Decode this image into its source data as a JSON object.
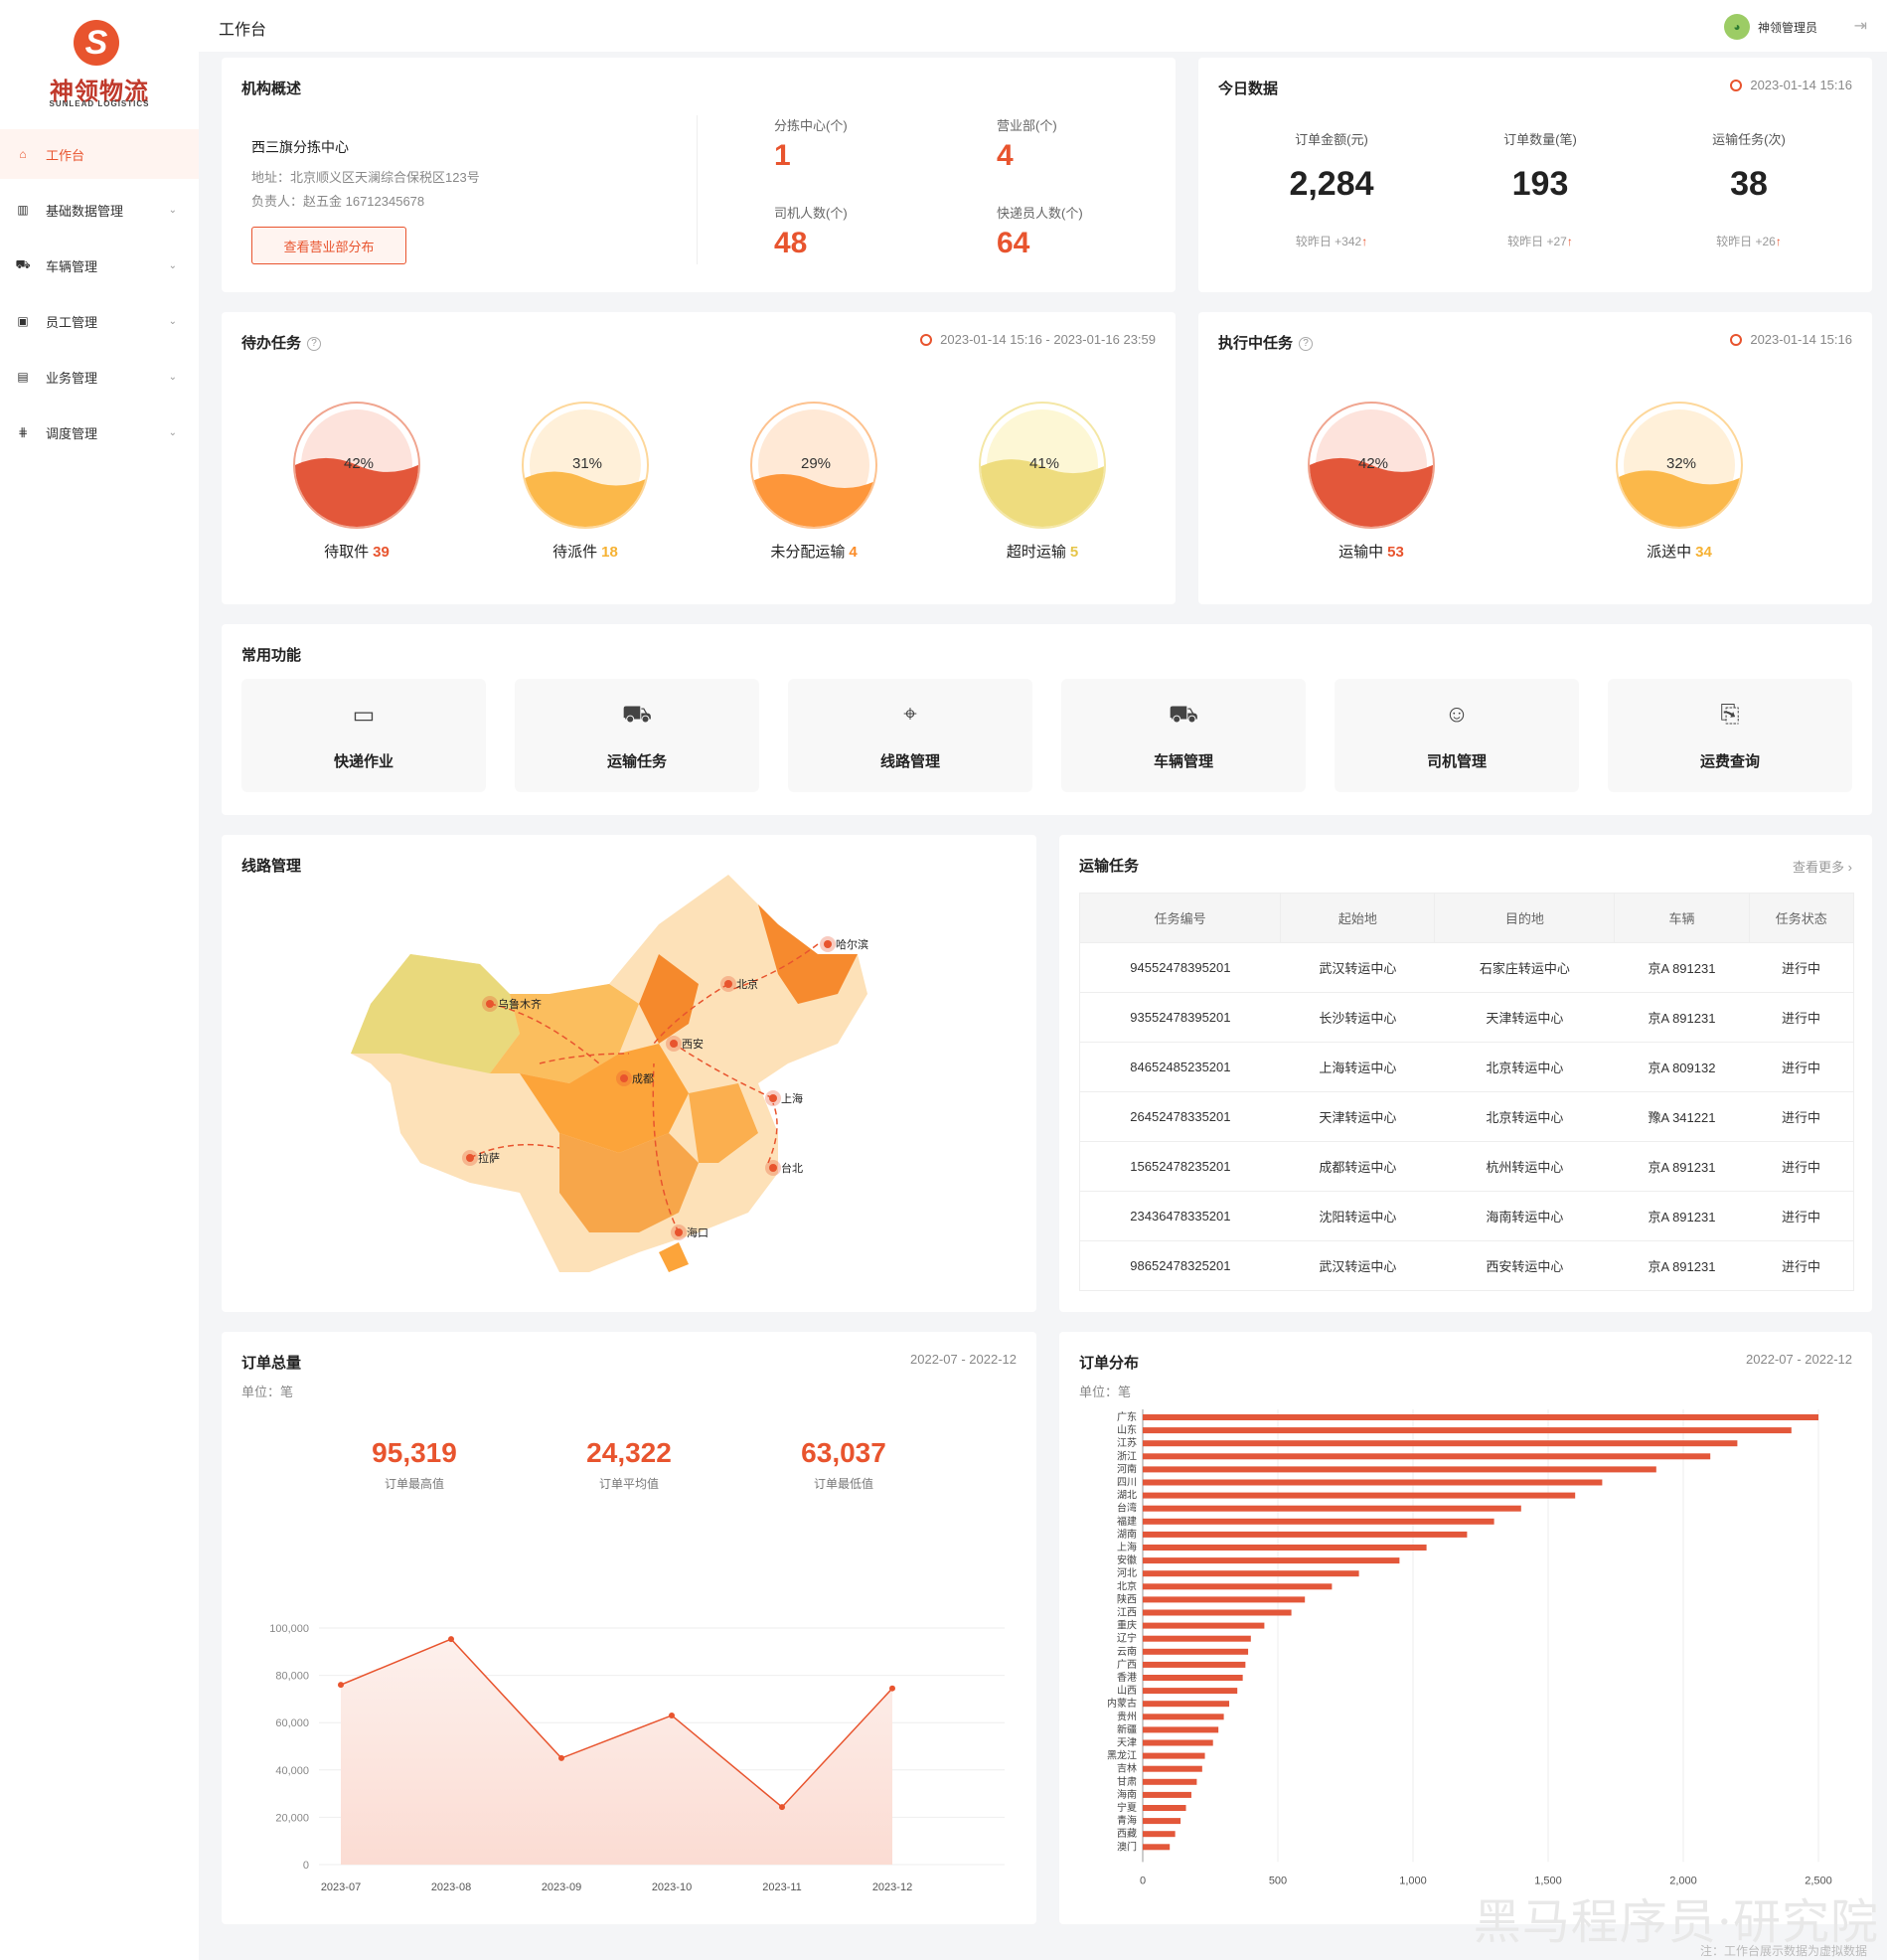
{
  "logo": {
    "mark": "S",
    "cn": "神领物流",
    "en": "SUNLEAD LOGISTICS"
  },
  "sidebar": {
    "items": [
      {
        "label": "工作台",
        "icon": "home-icon",
        "glyph": "⌂"
      },
      {
        "label": "基础数据管理",
        "icon": "bar-chart-icon",
        "glyph": "▥"
      },
      {
        "label": "车辆管理",
        "icon": "truck-icon",
        "glyph": "⛟"
      },
      {
        "label": "员工管理",
        "icon": "badge-icon",
        "glyph": "▣"
      },
      {
        "label": "业务管理",
        "icon": "document-icon",
        "glyph": "▤"
      },
      {
        "label": "调度管理",
        "icon": "dispatch-icon",
        "glyph": "⋕"
      }
    ]
  },
  "header": {
    "title": "工作台",
    "user": "神领管理员"
  },
  "org": {
    "title": "机构概述",
    "name": "西三旗分拣中心",
    "address": "地址：北京顺义区天澜综合保税区123号",
    "manager": "负责人：赵五金 16712345678",
    "button": "查看营业部分布",
    "stats": [
      {
        "label": "分拣中心(个)",
        "value": "1"
      },
      {
        "label": "营业部(个)",
        "value": "4"
      },
      {
        "label": "司机人数(个)",
        "value": "48"
      },
      {
        "label": "快递员人数(个)",
        "value": "64"
      }
    ]
  },
  "today": {
    "title": "今日数据",
    "time": "2023-01-14 15:16",
    "items": [
      {
        "label": "订单金额(元)",
        "value": "2,284",
        "compare": "较昨日 +342"
      },
      {
        "label": "订单数量(笔)",
        "value": "193",
        "compare": "较昨日 +27"
      },
      {
        "label": "运输任务(次)",
        "value": "38",
        "compare": "较昨日 +26"
      }
    ]
  },
  "pending": {
    "title": "待办任务",
    "range": "2023-01-14 15:16 - 2023-01-16 23:59",
    "gauges": [
      {
        "pct": "42%",
        "level": 0.42,
        "label": "待取件",
        "count": "39",
        "color": "#e3573a",
        "bg": "#fde3dc",
        "ring": "#f0a58f",
        "ncolor": "#e8542e"
      },
      {
        "pct": "31%",
        "level": 0.31,
        "label": "待派件",
        "count": "18",
        "color": "#fbb84a",
        "bg": "#fff0d9",
        "ring": "#fdd79a",
        "ncolor": "#f6b234"
      },
      {
        "pct": "29%",
        "level": 0.29,
        "label": "未分配运输",
        "count": "4",
        "color": "#fd963a",
        "bg": "#ffe9d6",
        "ring": "#fdc28f",
        "ncolor": "#fb8d2b"
      },
      {
        "pct": "41%",
        "level": 0.41,
        "label": "超时运输",
        "count": "5",
        "color": "#eedc7e",
        "bg": "#fdf7d5",
        "ring": "#f4e7a6",
        "ncolor": "#e6c54a"
      }
    ]
  },
  "executing": {
    "title": "执行中任务",
    "time": "2023-01-14 15:16",
    "gauges": [
      {
        "pct": "42%",
        "level": 0.42,
        "label": "运输中",
        "count": "53",
        "color": "#e3573a",
        "bg": "#fde3dc",
        "ring": "#f0a58f",
        "ncolor": "#e8542e"
      },
      {
        "pct": "32%",
        "level": 0.32,
        "label": "派送中",
        "count": "34",
        "color": "#fbb84a",
        "bg": "#fff0d9",
        "ring": "#fdd79a",
        "ncolor": "#f6b234"
      }
    ]
  },
  "functions": {
    "title": "常用功能",
    "items": [
      {
        "label": "快递作业",
        "icon": "parcel-box-icon",
        "glyph": "▭"
      },
      {
        "label": "运输任务",
        "icon": "transport-truck-icon",
        "glyph": "⛟"
      },
      {
        "label": "线路管理",
        "icon": "route-icon",
        "glyph": "⌖"
      },
      {
        "label": "车辆管理",
        "icon": "vehicle-icon",
        "glyph": "⛟"
      },
      {
        "label": "司机管理",
        "icon": "driver-icon",
        "glyph": "☺"
      },
      {
        "label": "运费查询",
        "icon": "freight-query-icon",
        "glyph": "⎘"
      }
    ]
  },
  "routes": {
    "title": "线路管理",
    "cities": [
      "乌鲁木齐",
      "哈尔滨",
      "北京",
      "西安",
      "上海",
      "成都",
      "拉萨",
      "台北",
      "海口"
    ]
  },
  "tasks": {
    "title": "运输任务",
    "more": "查看更多",
    "columns": [
      "任务编号",
      "起始地",
      "目的地",
      "车辆",
      "任务状态"
    ],
    "rows": [
      [
        "94552478395201",
        "武汉转运中心",
        "石家庄转运中心",
        "京A 891231",
        "进行中"
      ],
      [
        "93552478395201",
        "长沙转运中心",
        "天津转运中心",
        "京A 891231",
        "进行中"
      ],
      [
        "84652485235201",
        "上海转运中心",
        "北京转运中心",
        "京A 809132",
        "进行中"
      ],
      [
        "26452478335201",
        "天津转运中心",
        "北京转运中心",
        "豫A 341221",
        "进行中"
      ],
      [
        "15652478235201",
        "成都转运中心",
        "杭州转运中心",
        "京A 891231",
        "进行中"
      ],
      [
        "23436478335201",
        "沈阳转运中心",
        "海南转运中心",
        "京A 891231",
        "进行中"
      ],
      [
        "98652478325201",
        "武汉转运中心",
        "西安转运中心",
        "京A 891231",
        "进行中"
      ]
    ]
  },
  "orders": {
    "title": "订单总量",
    "range": "2022-07 - 2022-12",
    "unit": "单位：笔",
    "summary": [
      {
        "value": "95,319",
        "label": "订单最高值"
      },
      {
        "value": "24,322",
        "label": "订单平均值"
      },
      {
        "value": "63,037",
        "label": "订单最低值"
      }
    ]
  },
  "dist": {
    "title": "订单分布",
    "range": "2022-07 - 2022-12",
    "unit": "单位：笔"
  },
  "chart_data": [
    {
      "type": "area",
      "x": [
        "2023-07",
        "2023-08",
        "2023-09",
        "2023-10",
        "2023-11",
        "2023-12"
      ],
      "values": [
        76000,
        95319,
        45000,
        63037,
        24322,
        74500
      ],
      "ylim": [
        0,
        100000
      ],
      "yticks": [
        "0",
        "20,000",
        "40,000",
        "60,000",
        "80,000",
        "100,000"
      ],
      "grid": true,
      "color": "#e8542e"
    },
    {
      "type": "bar",
      "orientation": "horizontal",
      "categories": [
        "广东",
        "山东",
        "江苏",
        "浙江",
        "河南",
        "四川",
        "湖北",
        "台湾",
        "福建",
        "湖南",
        "上海",
        "安徽",
        "河北",
        "北京",
        "陕西",
        "江西",
        "重庆",
        "辽宁",
        "云南",
        "广西",
        "香港",
        "山西",
        "内蒙古",
        "贵州",
        "新疆",
        "天津",
        "黑龙江",
        "吉林",
        "甘肃",
        "海南",
        "宁夏",
        "青海",
        "西藏",
        "澳门"
      ],
      "values": [
        2500,
        2400,
        2200,
        2100,
        1900,
        1700,
        1600,
        1400,
        1300,
        1200,
        1050,
        950,
        800,
        700,
        600,
        550,
        450,
        400,
        390,
        380,
        370,
        350,
        320,
        300,
        280,
        260,
        230,
        220,
        200,
        180,
        160,
        140,
        120,
        100
      ],
      "xlim": [
        0,
        2500
      ],
      "xticks": [
        "0",
        "500",
        "1,000",
        "1,500",
        "2,000",
        "2,500"
      ],
      "grid": true,
      "color": "#e3573a"
    }
  ],
  "watermark": "黑马程序员·研究院",
  "footnote": "注：工作台展示数据为虚拟数据"
}
